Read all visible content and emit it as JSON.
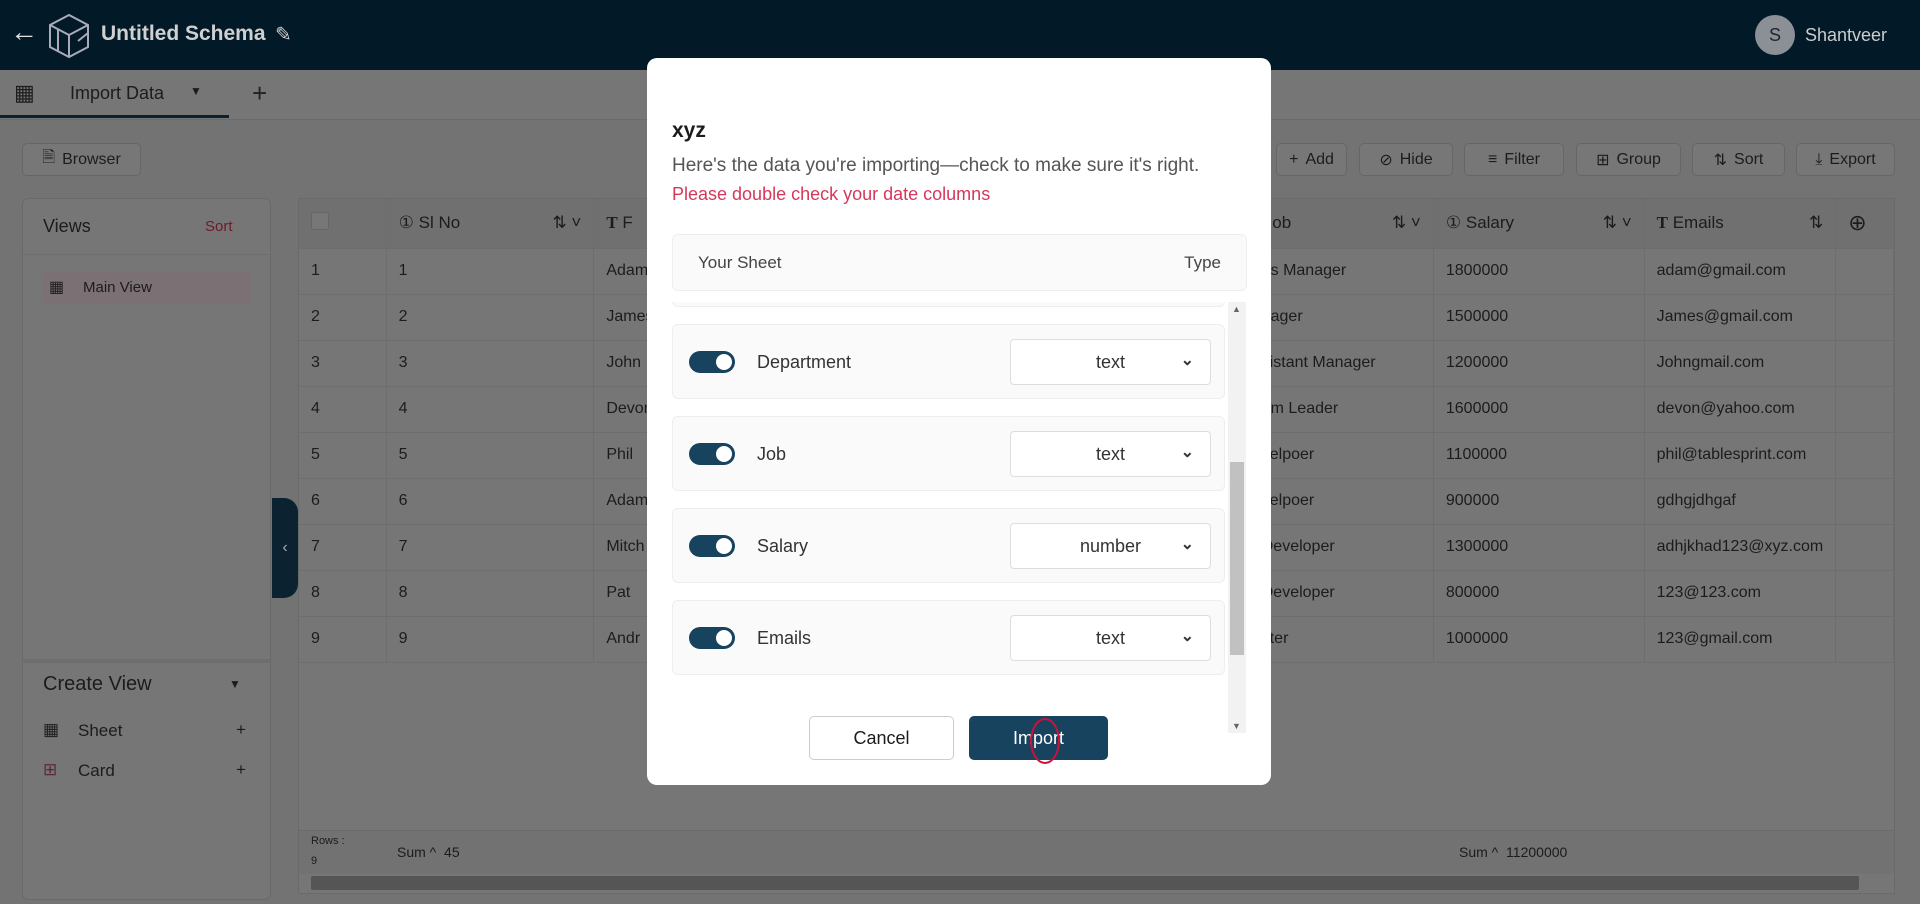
{
  "header": {
    "title": "Untitled Schema",
    "user_initial": "S",
    "user_name": "Shantveer"
  },
  "tabs": {
    "active": "Import Data",
    "add": "+"
  },
  "toolbar": {
    "browser": "Browser",
    "add": "Add",
    "hide": "Hide",
    "filter": "Filter",
    "group": "Group",
    "sort": "Sort",
    "export": "Export"
  },
  "views": {
    "title": "Views",
    "sort": "Sort",
    "main_view": "Main View",
    "create_view": "Create View",
    "sheet": "Sheet",
    "card": "Card",
    "plus": "+"
  },
  "table": {
    "headers": {
      "slno": "Sl No",
      "name": "F",
      "job": "Job",
      "salary": "Salary",
      "emails": "Emails"
    },
    "rows": [
      {
        "idx": "1",
        "slno": "1",
        "name": "Adam",
        "job": "es Manager",
        "salary": "1800000",
        "email": "adam@gmail.com"
      },
      {
        "idx": "2",
        "slno": "2",
        "name": "James",
        "job": "nager",
        "salary": "1500000",
        "email": "James@gmail.com"
      },
      {
        "idx": "3",
        "slno": "3",
        "name": "John",
        "job": "sistant Manager",
        "salary": "1200000",
        "email": "Johngmail.com"
      },
      {
        "idx": "4",
        "slno": "4",
        "name": "Devon",
        "job": "am Leader",
        "salary": "1600000",
        "email": "devon@yahoo.com"
      },
      {
        "idx": "5",
        "slno": "5",
        "name": "Phil",
        "job": "velpoer",
        "salary": "1100000",
        "email": "phil@tablesprint.com"
      },
      {
        "idx": "6",
        "slno": "6",
        "name": "Adam",
        "job": "velpoer",
        "salary": "900000",
        "email": "gdhgjdhgaf"
      },
      {
        "idx": "7",
        "slno": "7",
        "name": "Mitch",
        "job": "Developer",
        "salary": "1300000",
        "email": "adhjkhad123@xyz.com"
      },
      {
        "idx": "8",
        "slno": "8",
        "name": "Pat",
        "job": "Developer",
        "salary": "800000",
        "email": "123@123.com"
      },
      {
        "idx": "9",
        "slno": "9",
        "name": "Andr",
        "job": "ster",
        "salary": "1000000",
        "email": "123@gmail.com"
      }
    ],
    "footer": {
      "rows_label": "Rows :",
      "rows_count": "9",
      "sum_label": "Sum",
      "slno_sum": "45",
      "salary_sum": "11200000"
    }
  },
  "modal": {
    "title": "xyz",
    "subtitle": "Here's the data you're importing—check to make sure it's right.",
    "warning": "Please double check your date columns",
    "col_sheet": "Your Sheet",
    "col_type": "Type",
    "fields": [
      {
        "name": "Department",
        "type": "text",
        "enabled": true
      },
      {
        "name": "Job",
        "type": "text",
        "enabled": true
      },
      {
        "name": "Salary",
        "type": "number",
        "enabled": true
      },
      {
        "name": "Emails",
        "type": "text",
        "enabled": true
      }
    ],
    "cancel": "Cancel",
    "import": "Import"
  },
  "colors": {
    "header_bg": "#05334e",
    "primary": "#17435e",
    "warning": "#d6375a"
  }
}
